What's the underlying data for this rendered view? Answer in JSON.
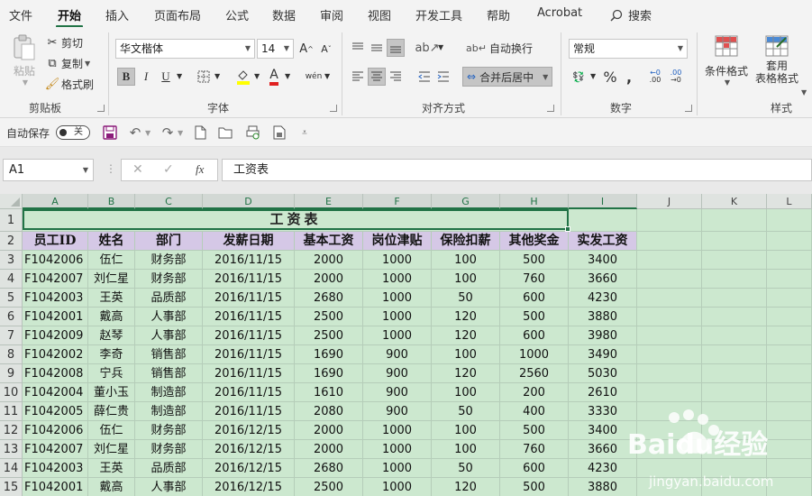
{
  "menu": {
    "tabs": [
      "文件",
      "开始",
      "插入",
      "页面布局",
      "公式",
      "数据",
      "审阅",
      "视图",
      "开发工具",
      "帮助",
      "Acrobat"
    ],
    "active_tab": "开始",
    "search_label": "搜索"
  },
  "ribbon": {
    "clipboard": {
      "paste": "粘贴",
      "cut": "剪切",
      "copy": "复制",
      "format_painter": "格式刷",
      "label": "剪贴板"
    },
    "font": {
      "font_name": "华文楷体",
      "font_size": "14",
      "bold": "B",
      "italic": "I",
      "underline": "U",
      "label": "字体"
    },
    "alignment": {
      "wrap_text": "自动换行",
      "merge_center": "合并后居中",
      "label": "对齐方式"
    },
    "number": {
      "format": "常规",
      "label": "数字"
    },
    "styles": {
      "conditional_format": "条件格式",
      "table_format_line1": "套用",
      "table_format_line2": "表格格式",
      "label": "样式"
    }
  },
  "qat": {
    "autosave_label": "自动保存",
    "autosave_state": "关"
  },
  "formula_bar": {
    "name_box": "A1",
    "fx": "fx",
    "content": "工资表"
  },
  "sheet": {
    "columns": [
      "A",
      "B",
      "C",
      "D",
      "E",
      "F",
      "G",
      "H",
      "I",
      "J",
      "K",
      "L"
    ],
    "row_numbers": [
      "1",
      "2",
      "3",
      "4",
      "5",
      "6",
      "7",
      "8",
      "9",
      "10",
      "11",
      "12",
      "13",
      "14",
      "15"
    ],
    "title": "工资表",
    "headers": [
      "员工ID",
      "姓名",
      "部门",
      "发薪日期",
      "基本工资",
      "岗位津贴",
      "保险扣薪",
      "其他奖金",
      "实发工资"
    ],
    "rows": [
      [
        "F1042006",
        "伍仁",
        "财务部",
        "2016/11/15",
        "2000",
        "1000",
        "100",
        "500",
        "3400"
      ],
      [
        "F1042007",
        "刘仁星",
        "财务部",
        "2016/11/15",
        "2000",
        "1000",
        "100",
        "760",
        "3660"
      ],
      [
        "F1042003",
        "王英",
        "品质部",
        "2016/11/15",
        "2680",
        "1000",
        "50",
        "600",
        "4230"
      ],
      [
        "F1042001",
        "戴高",
        "人事部",
        "2016/11/15",
        "2500",
        "1000",
        "120",
        "500",
        "3880"
      ],
      [
        "F1042009",
        "赵琴",
        "人事部",
        "2016/11/15",
        "2500",
        "1000",
        "120",
        "600",
        "3980"
      ],
      [
        "F1042002",
        "李奇",
        "销售部",
        "2016/11/15",
        "1690",
        "900",
        "100",
        "1000",
        "3490"
      ],
      [
        "F1042008",
        "宁兵",
        "销售部",
        "2016/11/15",
        "1690",
        "900",
        "120",
        "2560",
        "5030"
      ],
      [
        "F1042004",
        "董小玉",
        "制造部",
        "2016/11/15",
        "1610",
        "900",
        "100",
        "200",
        "2610"
      ],
      [
        "F1042005",
        "薛仁贵",
        "制造部",
        "2016/11/15",
        "2080",
        "900",
        "50",
        "400",
        "3330"
      ],
      [
        "F1042006",
        "伍仁",
        "财务部",
        "2016/12/15",
        "2000",
        "1000",
        "100",
        "500",
        "3400"
      ],
      [
        "F1042007",
        "刘仁星",
        "财务部",
        "2016/12/15",
        "2000",
        "1000",
        "100",
        "760",
        "3660"
      ],
      [
        "F1042003",
        "王英",
        "品质部",
        "2016/12/15",
        "2680",
        "1000",
        "50",
        "600",
        "4230"
      ],
      [
        "F1042001",
        "戴高",
        "人事部",
        "2016/12/15",
        "2500",
        "1000",
        "120",
        "500",
        "3880"
      ]
    ]
  },
  "watermark": {
    "brand": "Baidu经验",
    "url": "jingyan.baidu.com"
  },
  "colors": {
    "accent": "#217346",
    "sheet_bg": "#cce8cf",
    "header_bg": "#d5c8e6"
  }
}
